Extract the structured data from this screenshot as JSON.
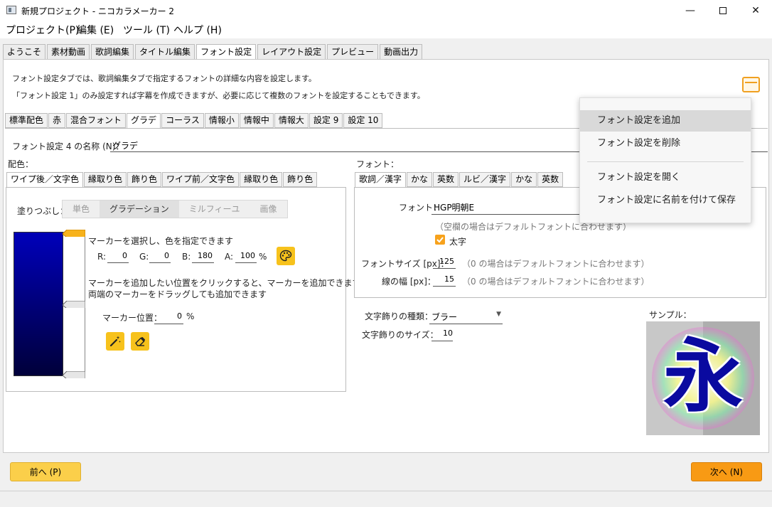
{
  "window": {
    "title": "新規プロジェクト - ニコカラメーカー 2"
  },
  "menu": [
    "プロジェクト(P)",
    "編集 (E)",
    "ツール (T)",
    "ヘルプ (H)"
  ],
  "main_tabs": [
    "ようこそ",
    "素材動画",
    "歌詞編集",
    "タイトル編集",
    "フォント設定",
    "レイアウト設定",
    "プレビュー",
    "動画出力"
  ],
  "description": {
    "line1": "フォント設定タブでは、歌詞編集タブで指定するフォントの詳細な内容を設定します。",
    "line2": "「フォント設定 1」のみ設定すれば字幕を作成できますが、必要に応じて複数のフォントを設定することもできます。"
  },
  "font_tabs": [
    "標準配色",
    "赤",
    "混合フォント",
    "グラデ",
    "コーラス",
    "情報小",
    "情報中",
    "情報大",
    "設定 9",
    "設定 10"
  ],
  "name_field": {
    "label": "フォント設定 4 の名称 (N)：",
    "value": "グラデ"
  },
  "color_section": {
    "label": "配色：",
    "tabs": [
      "ワイプ後／文字色",
      "縁取り色",
      "飾り色",
      "ワイプ前／文字色",
      "縁取り色",
      "飾り色"
    ],
    "fill_label": "塗りつぶし：",
    "fill_modes": [
      "単色",
      "グラデーション",
      "ミルフィーユ",
      "画像"
    ],
    "marker_hint": "マーカーを選択し、色を指定できます",
    "r_label": "R:",
    "r": "0",
    "g_label": "G:",
    "g": "0",
    "b_label": "B:",
    "b": "180",
    "a_label": "A:",
    "a": "100",
    "percent": "%",
    "add_hint1": "マーカーを追加したい位置をクリックすると、マーカーを追加できます",
    "add_hint2": "両端のマーカーをドラッグしても追加できます",
    "marker_pos_label": "マーカー位置：",
    "marker_pos": "0",
    "marker_pos_unit": "%"
  },
  "font_section": {
    "label": "フォント：",
    "tabs": [
      "歌詞／漢字",
      "かな",
      "英数",
      "ルビ／漢字",
      "かな",
      "英数"
    ],
    "font_label": "フォント：",
    "font_value": "HGP明朝E",
    "font_hint": "（空欄の場合はデフォルトフォントに合わせます）",
    "bold_label": "太字",
    "size_label": "フォントサイズ [px]：",
    "size_value": "125",
    "size_hint": "（0 の場合はデフォルトフォントに合わせます）",
    "line_label": "線の幅 [px]：",
    "line_value": "15",
    "line_hint": "（0 の場合はデフォルトフォントに合わせます）"
  },
  "decoration": {
    "type_label": "文字飾りの種類：",
    "type_value": "ブラー",
    "size_label": "文字飾りのサイズ：",
    "size_value": "10"
  },
  "sample": {
    "label": "サンプル：",
    "glyph": "永"
  },
  "popup_menu": [
    "フォント設定を追加",
    "フォント設定を削除",
    "フォント設定を開く",
    "フォント設定に名前を付けて保存"
  ],
  "buttons": {
    "prev": "前へ (P)",
    "next": "次へ (N)"
  },
  "colors": {
    "accent": "#f7c21c",
    "next_button": "#f89a14",
    "gradient_top": "#0000b4"
  }
}
